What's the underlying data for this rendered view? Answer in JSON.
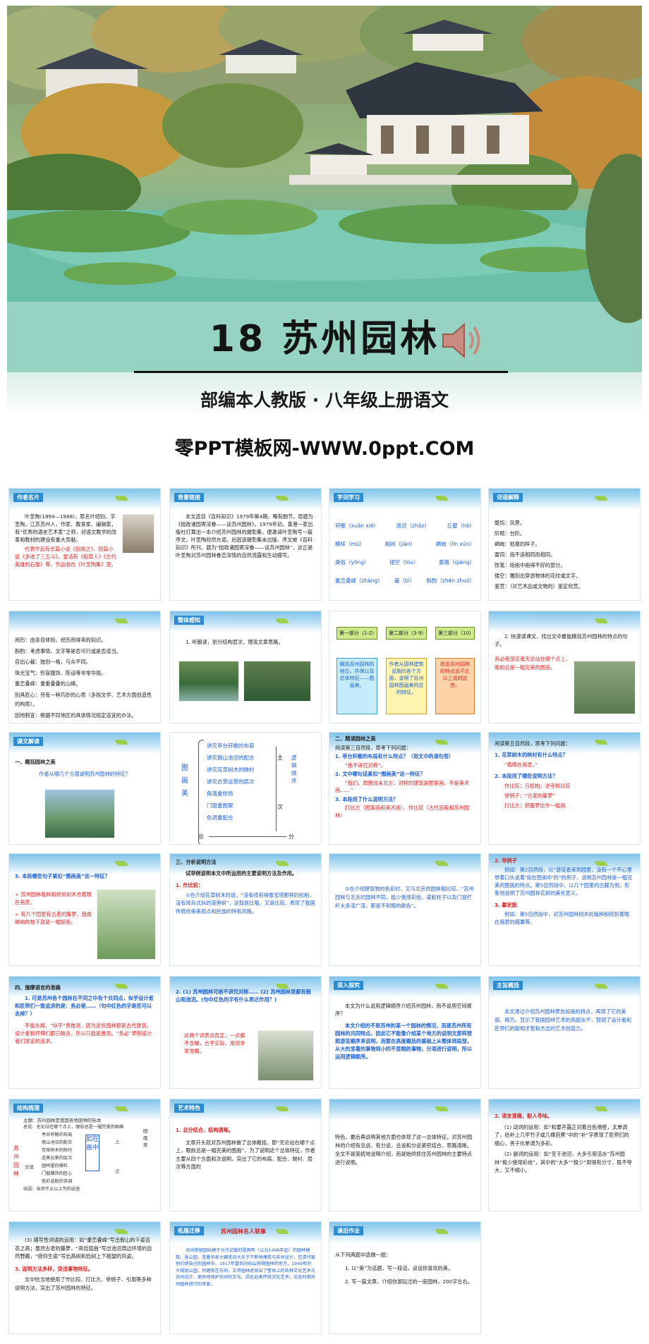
{
  "cover": {
    "title": "18 苏州园林",
    "subtitle": "部编本人教版 · 八年级上册语文",
    "site": "零PPT模板网-WWW.0ppt.COM"
  },
  "slides": {
    "s1": {
      "tag": "作者名片",
      "p1": "叶圣陶(1894—1988)，原名叶绍钧，字圣陶，江苏苏州人，作家、教育家、编辑家，有“优秀的语言艺术家”之称，对语文教学的改革和教材的建设有重大贡献。",
      "p2": "代表作品有长篇小说《倪焕之》，短篇小说《多收了三五斗》，童话有《稻草人》《古代英雄的石像》等，作品收在《叶圣陶集》里。"
    },
    "s2": {
      "tag": "背景链接",
      "p1": "本文选自《百科知识》1979年第4期。略有删节。原题为《拙政诸园寄深眷——谈苏州园林》。1979年初，香港一家出版社打算出一本介绍苏州园林的摄影集，便邀请叶圣陶写一篇序文，叶圣陶欣然允诺。后因该摄影集未出版，序文被《百科知识》所刊，题为“拙政诸园寄深眷——谈苏州园林”，这正是叶圣陶对苏州园林眷恋深情的自然流露和生动描写。"
    },
    "s3": {
      "tag": "字词学习",
      "rows": [
        [
          "轩榭（xuān xiè）",
          "池沼（zhǎo）",
          "丘壑（hè）"
        ],
        [
          "模样（mú）",
          "相间（jiàn）",
          "嶙峋（lín xún）"
        ],
        [
          "庚俗（yōng）",
          "镂空（lòu）",
          "蔷薇（qiáng）"
        ],
        [
          "重峦叠嶂（zhàng）",
          "蔽（bì）",
          "斟酌（zhēn zhuó）"
        ]
      ]
    },
    "s4": {
      "tag": "词语解释",
      "items": [
        "整饬：风景。",
        "阶砌：台阶。",
        "嶙峋：枯瘦的样子。",
        "雷同：指不该相同而相同。",
        "败笔：绘画中画得不好的部分。",
        "镂空：雕刻出穿透物体的花纹或文字。",
        "鉴赏：（对艺术品或文物的）鉴定欣赏。"
      ]
    },
    "s5": {
      "items": [
        "阅历：由亲自体验、经历而得来的知识。",
        "斟酌：考虑事情、文字等是否可行或是否适当。",
        "自出心裁：独创一格，与众不同。",
        "珠光宝气：形容服饰、陈设等非常华丽。",
        "重峦叠嶂：重重叠叠的山峰。",
        "别具匠心：另有一种巧妙的心思（多指文学、艺术方面创造性的构思）。",
        "因地制宜：根据不同地区的具体情况规定适宜的办法。"
      ]
    },
    "s6": {
      "tag": "整体感知",
      "text": "1. 听朗读，划分结构层次，理清文章思路。"
    },
    "s7": {
      "parts": [
        {
          "title": "第一部分（1-2）",
          "text": "概括苏州园林的地位，并保以及总体特征——图画美。"
        },
        {
          "title": "第二部分（3-9）",
          "text": "作者从园林建筑设施的各个方面，说明了苏州园林图画美的总的特征。"
        },
        {
          "title": "第三部分（10）",
          "text": "指出苏州园林的特点远不止以上说的这些。"
        }
      ]
    },
    "s8": {
      "q": "2. 快速读课文，找出文中最能概括苏州园林的特点的句子。",
      "a": "务必使游览者无论站在哪个点上，眼前总是一幅完美的图画。"
    },
    "s9": {
      "tag": "课文解读",
      "head": "一、概括园林之美",
      "q": "作者从哪几个方面说明苏州园林的特征？"
    },
    "s10": {
      "left": "图画美",
      "items": [
        "讲究亭台轩榭的布局",
        "讲究假山池沼的配合",
        "讲究花草树木的映衬",
        "讲究近景远景的层次",
        "角落重修饰",
        "门窗重图案",
        "色调重配合"
      ],
      "zhu": "主",
      "ci": "次",
      "zong": "总",
      "fen": "分",
      "order": "逻辑顺序"
    },
    "s11": {
      "head": "二、精读园林之美",
      "lead": "阅读第三自然段，思考下列问题：",
      "q1": "1. 亭台轩榭的布局有什么特点？（用文中的语句答）",
      "a1": "“绝不讲究对称”。",
      "q2": "2. 文中哪句话紧扣“图画美”这一特征？",
      "a2": "“我们，周围尚未北方，对称的建筑是图案画，不是美术画……”",
      "q3": "3. 本段用了什么说明方法？",
      "a3": "打比方（图案画和美术画）、作比较（古代宫殿和苏州园林）"
    },
    "s12": {
      "lead": "阅读第五自然段，思考下列问题：",
      "q1": "1. 花草树木的映衬有什么特点？",
      "a1": "“着眼在画意。”",
      "q2": "2. 本段用了哪些说明方法？",
      "a2": [
        "作比较：与松柏，进寺树比较",
        "举例子：“古老的藤萝”",
        "打比方：把藤萝比作一幅画"
      ]
    },
    "s13": {
      "q": "3. 本段哪些句子紧扣“图画美”这一特征？",
      "items": [
        "苏州园林栽种和修剪树木也着眼在画意。",
        "有几个园里有古老的藤萝，盘曲嶙峋的枝干就是一幅好画。"
      ]
    },
    "s14": {
      "head": "三、分析说明方法",
      "lead": "试举例说明本文中所运用的主要说明方法及作用。",
      "sub": "1. 作比较：",
      "text": "①在介绍花草树木时说，“没有修剪得像宝塔那样的松柏，没有阅兵式似的道旁树”，这既是比喻，又是比较，表现了我国传统的审美观点和民族的特有风格。"
    },
    "s15": {
      "text": "②在介绍建筑物的色彩时，又与北京的园林相比较，“苏州园林与北京的园林不同，极少使用彩绘。梁和柱子以及门窗栏杆大多漆广漆，那是不刺眼的颜色”。"
    },
    "s16": {
      "sub1": "2. 举例子",
      "t1": "例如：第2自然段，以“游览者来到园里，没有一个不心里想着口头说着‘如在图画中’的”的例子，说明苏州园林是一幅完美的图画的特点。第5自然段中，以几个园里的古藤为例，形象地说明了苏州园林花树的美化意义。",
      "sub2": "3. 摹状貌",
      "t2": "例如：第5自然段中，对苏州园林树木的栽种和修剪着眼在画意的描摹等。"
    },
    "s17": {
      "head": "四、揣摩语言的准确",
      "q": "1. 可是苏州各个园林在不同之中有个共同点，似乎设计者和匠师们一致追求的是：务必使……（句中红色的字是否可以去掉？）",
      "a": "不能去掉。“似乎”表推测，因为这些园林都是古代建筑，设计者和师傅们都已故去，所以只能是推测。“务必”表明设计者们坚定的追求。"
    },
    "s18": {
      "q": "2. (1) 苏州园林可绝不讲究对称…… (2) 苏州园林里都有假山和池沼。(句中红色的字有什么表达作用？)",
      "a": "这两个词表达肯定，一点都不含糊，合乎实际，用词非常准确。"
    },
    "s19": {
      "tag": "深入探究",
      "q": "本文为什么说用逻辑顺序介绍苏州园林，而不说用空间顺序？",
      "a": "本文介绍的不是苏州的某一个园林的情况，而是苏州所有园林的共同特点，因此它不能像介绍某个地方的说明文那样按照游览顺序来说明，而要在高度概括的基础上从整体到局部，从大的显著的事物到小的不显眼的事物，分项进行说明，所以运用逻辑顺序。"
    },
    "s20": {
      "tag": "主旨概括",
      "text": "本文通过介绍苏州园林景色如画的特点，再现了它的美丽、精巧，显示了我国园林艺术的高超水平，赞颂了设计者和匠师们的聪明才智和杰出的艺术创造力。"
    },
    "s21": {
      "tag": "结构梳理",
      "lead": "主题：苏州园林是我国各地园林的标本",
      "items": [
        "总说：无论站在哪个点上，眼前总是一幅完美的图画",
        "亭台轩榭的布局",
        "假山池沼的配合",
        "花草树木的映衬",
        "近景远景的层次",
        "园林里的栅栏",
        "门窗雕饰的匠心",
        "色彩选配的协调",
        "结语：自然不止以上写的这些"
      ],
      "left": "苏州园林",
      "mid": "如在画中",
      "fen": "分说",
      "shang": "上",
      "zhi": "之",
      "right": "园画美"
    },
    "s22": {
      "tag": "艺术特色",
      "sub": "1. 总分结合，结构清晰。",
      "text": "文章开头就对苏州园林做了总体概括，即“无论站在哪个点上，眼前总是一幅完美的图画”，为了说明这个总体特征，作者主要从四个方面和次说明，突出了它的布局、配合、映衬、层次等方面的"
    },
    "s23": {
      "text": "特色，最后再说明其他方面也体现了这一总体特征。对苏州园林的介绍有总说、有分说，总说和分说紧密结合，思路清晰。全文不是笼统地说明介绍，而是始终抓住苏州园林的主要特点进行说明。"
    },
    "s24": {
      "sub": "2. 语言准确，耐人寻味。",
      "t1": "(1) 动词的运用：如“和要开露正对着白色墙壁，太单调了，给补上几竿竹子或几棵芭蕉”中的“补”字表现了匠师们的细心，善于化单调为多彩。",
      "t2": "(2) 副词的运用：如“至于池沼，大多引用活水”苏州园林“极少使用彩绘”，其中的“大多”“极少”用得有分寸，既不夸大，又不缩小。"
    },
    "s25": {
      "t1": "(3) 描写性词语的运用：如“重峦叠嶂”写出假山的千姿百态之高；虽然古老的藤萝，“高低屈曲”写出池沼周边环境的自然野趣，“俯仰生姿”写出高树和低树上下相望的风姿。",
      "sub": "3. 说明方法多样，突出事物特征。",
      "t2": "文中恰当地使用了作比较、打比方、举例子、引用等多种说明方法，突出了苏州园林的特征。"
    },
    "s26": {
      "tag": "拓展迁移",
      "title": "苏州园林名人轶事",
      "text": "苏州和留园始建于元代记载的是拥有（公元1498年起）的园林建筑。张公园，是著名家大藏史诗大夫于不断地建筑与苏州设计，在清代被他们使自己的园林中。1917年富商刘伯山购得园林的地方，1949年的大规划公园，将建筑在苏州，又将园林造就出了整体上的各种文化艺术与苏州设计，更好地保护苏州的文化、因此此类传统文化艺术，对此时期苏州园林进行的修复。"
    },
    "s27": {
      "tag": "课后作业",
      "lead": "从下列两题中选做一题：",
      "t1": "1. 以“美”为话题，写一段话，谈谈你喜欢的美。",
      "t2": "2. 写一篇文章，介绍你游玩过的一座园林，200字左右。"
    }
  }
}
